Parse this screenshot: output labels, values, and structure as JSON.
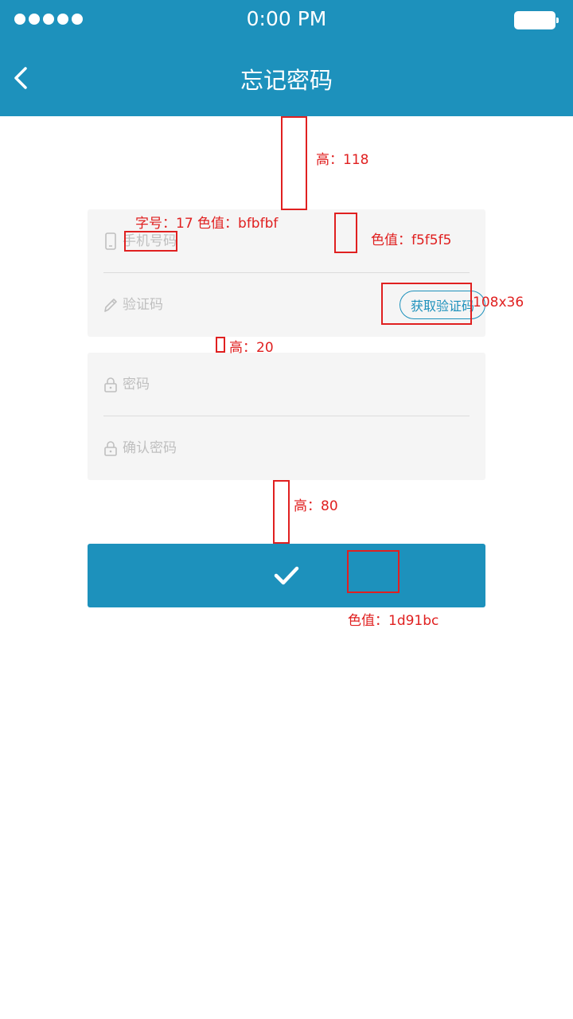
{
  "status_bar": {
    "time": "0:00 PM",
    "signal_dots": 5
  },
  "nav": {
    "title": "忘记密码",
    "back_icon": "chevron-left-icon"
  },
  "form": {
    "phone": {
      "placeholder": "手机号码",
      "icon": "phone-icon"
    },
    "code": {
      "placeholder": "验证码",
      "icon": "pencil-icon",
      "button_label": "获取验证码"
    },
    "password": {
      "placeholder": "密码",
      "icon": "lock-icon"
    },
    "confirm_password": {
      "placeholder": "确认密码",
      "icon": "lock-icon"
    },
    "submit_icon": "checkmark-icon"
  },
  "annotations": {
    "gap_top": "高：118",
    "font_spec": "字号：17  色值：bfbfbf",
    "panel_color": "色值：f5f5f5",
    "button_size": "108x36",
    "gap_panels": "高：20",
    "gap_button": "高：80",
    "button_color": "色值：1d91bc"
  },
  "colors": {
    "primary": "#1d91bc",
    "panel_bg": "#f5f5f5",
    "placeholder": "#bfbfbf",
    "annotation": "#e02020"
  }
}
